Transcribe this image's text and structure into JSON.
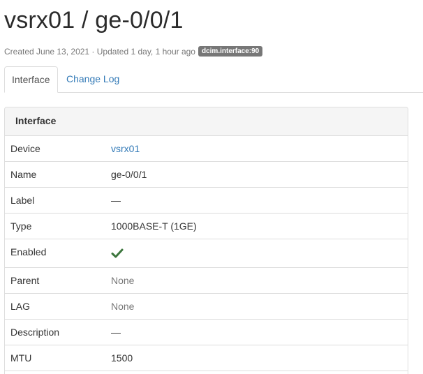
{
  "header": {
    "title": "vsrx01 / ge-0/0/1",
    "meta_text": "Created June 13, 2021 · Updated 1 day, 1 hour ago",
    "badge": "dcim.interface:90"
  },
  "tabs": [
    {
      "label": "Interface",
      "active": true
    },
    {
      "label": "Change Log",
      "active": false
    }
  ],
  "panel": {
    "heading": "Interface",
    "rows": [
      {
        "key": "Device",
        "value": "vsrx01"
      },
      {
        "key": "Name",
        "value": "ge-0/0/1"
      },
      {
        "key": "Label",
        "value": "—"
      },
      {
        "key": "Type",
        "value": "1000BASE-T (1GE)"
      },
      {
        "key": "Enabled",
        "value_icon": "check-icon"
      },
      {
        "key": "Parent",
        "value": "None"
      },
      {
        "key": "LAG",
        "value": "None"
      },
      {
        "key": "Description",
        "value": "—"
      },
      {
        "key": "MTU",
        "value": "1500"
      }
    ]
  },
  "colors": {
    "link": "#337ab7",
    "muted": "#777777",
    "success": "#3c763d",
    "badge_bg": "#777777"
  }
}
